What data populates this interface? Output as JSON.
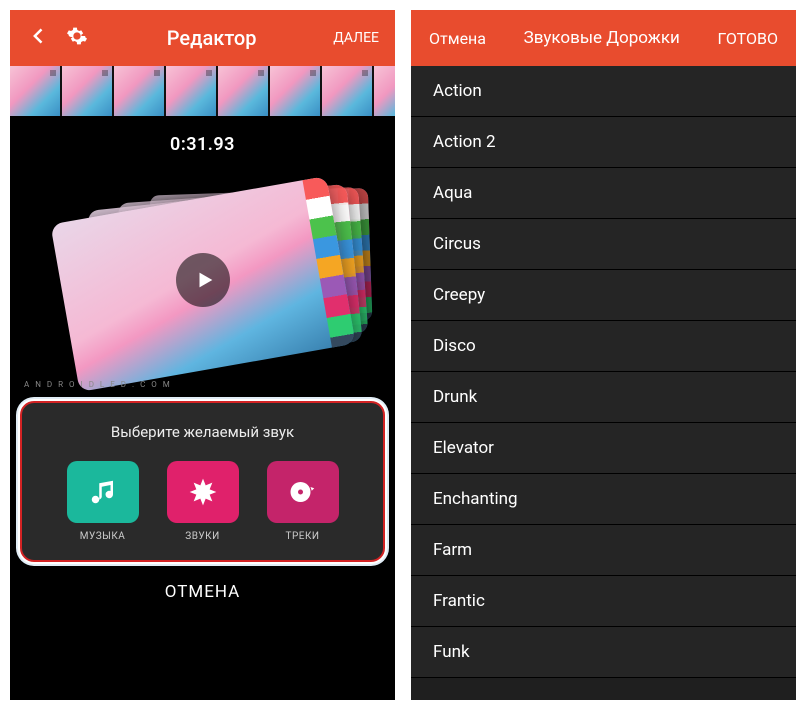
{
  "left": {
    "header": {
      "title": "Редактор",
      "next": "ДАЛЕЕ"
    },
    "timecode": "0:31.93",
    "watermark": "A N D R O I D L E D . C O M",
    "sheet": {
      "title": "Выберите желаемый звук",
      "music": "МУЗЫКА",
      "sounds": "ЗВУКИ",
      "tracks": "ТРЕКИ"
    },
    "cancel": "ОТМЕНА"
  },
  "right": {
    "header": {
      "cancel": "Отмена",
      "title": "Звуковые Дорожки",
      "done": "ГОТОВО"
    },
    "tracks": [
      "Action",
      "Action 2",
      "Aqua",
      "Circus",
      "Creepy",
      "Disco",
      "Drunk",
      "Elevator",
      "Enchanting",
      "Farm",
      "Frantic",
      "Funk"
    ]
  }
}
